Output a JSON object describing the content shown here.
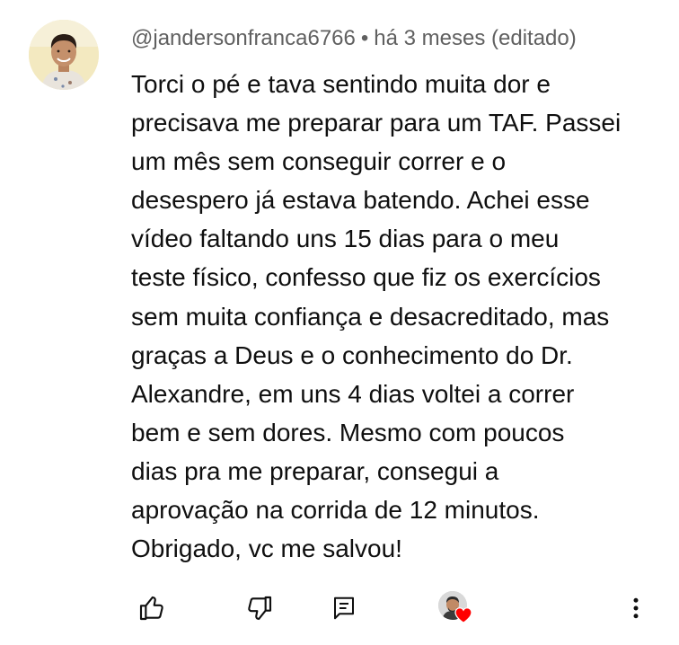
{
  "comment": {
    "author": "@jandersonfranca6766",
    "separator": "•",
    "time": "há 3 meses (editado)",
    "text_lines": [
      "Torci o pé e tava sentindo muita dor e",
      "precisava me preparar para um TAF. Passei",
      "um mês sem conseguir correr e o",
      "desespero já estava batendo. Achei esse",
      "vídeo faltando uns 15 dias para o meu",
      "teste físico, confesso que fiz os exercícios",
      "sem muita confiança e desacreditado, mas",
      "graças a Deus e o conhecimento do Dr.",
      "Alexandre, em uns 4 dias voltei a correr",
      "bem e sem dores. Mesmo com poucos",
      "dias pra me preparar, consegui a",
      "aprovação na corrida de 12 minutos.",
      "Obrigado, vc me salvou!"
    ]
  },
  "actions": {
    "like_icon": "thumbs-up-icon",
    "dislike_icon": "thumbs-down-icon",
    "reply_icon": "reply-icon",
    "creator_heart_icon": "creator-heart-icon",
    "more_icon": "more-vertical-icon"
  },
  "colors": {
    "text": "#0f0f0f",
    "meta": "#606060",
    "heart": "#ff0000"
  }
}
